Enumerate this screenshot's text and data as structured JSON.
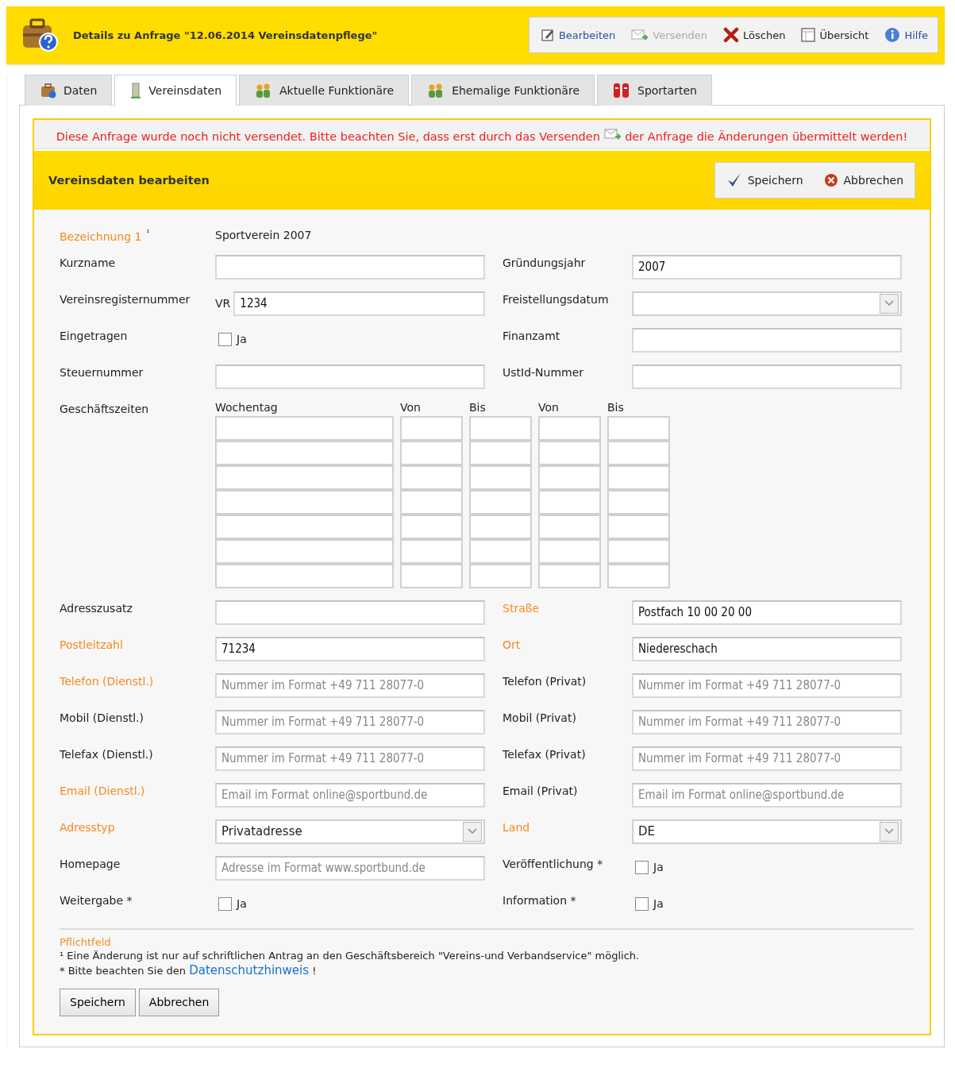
{
  "header": {
    "title": "Details zu  Anfrage \"12.06.2014 Vereinsdatenpflege\"",
    "actions": [
      {
        "kind": "edit",
        "label": "Bearbeiten",
        "disabled": false
      },
      {
        "kind": "send",
        "label": "Versenden",
        "disabled": true
      },
      {
        "kind": "delete",
        "label": "Löschen",
        "disabled": false
      },
      {
        "kind": "overview",
        "label": "Übersicht",
        "disabled": false
      },
      {
        "kind": "help",
        "label": "Hilfe",
        "disabled": false
      }
    ]
  },
  "tabs": [
    {
      "kind": "data",
      "label": "Daten",
      "selected": false
    },
    {
      "kind": "club",
      "label": "Vereinsdaten",
      "selected": true
    },
    {
      "kind": "people",
      "label": "Aktuelle Funktionäre",
      "selected": false
    },
    {
      "kind": "people",
      "label": "Ehemalige Funktionäre",
      "selected": false
    },
    {
      "kind": "sport",
      "label": "Sportarten",
      "selected": false
    }
  ],
  "notice": {
    "before": "Diese Anfrage wurde noch nicht versendet. Bitte beachten Sie, dass erst durch das Versenden",
    "after": "der Anfrage die Änderungen übermittelt werden!"
  },
  "section": {
    "title": "Vereinsdaten bearbeiten",
    "buttons": [
      {
        "kind": "save",
        "label": "Speichern"
      },
      {
        "kind": "cancel",
        "label": "Abbrechen"
      }
    ]
  },
  "rows": [
    [
      {
        "label": "Bezeichnung 1",
        "required": true,
        "marker": "¹",
        "kind": "static",
        "value": "Sportverein 2007"
      },
      null
    ],
    [
      {
        "label": "Kurzname",
        "required": false,
        "kind": "text"
      },
      {
        "label": "Gründungsjahr",
        "required": false,
        "kind": "text",
        "value": "2007"
      }
    ],
    [
      {
        "label": "Vereinsregisternummer",
        "required": false,
        "kind": "text",
        "prefix": "VR",
        "value": "1234"
      },
      {
        "label": "Freistellungsdatum",
        "required": false,
        "kind": "select"
      }
    ],
    [
      {
        "label": "Eingetragen",
        "required": false,
        "kind": "checkbox",
        "option": "Ja",
        "checked": false
      },
      {
        "label": "Finanzamt",
        "required": false,
        "kind": "text"
      }
    ],
    [
      {
        "label": "Steuernummer",
        "required": false,
        "kind": "text"
      },
      {
        "label": "UstId-Nummer",
        "required": false,
        "kind": "text"
      }
    ]
  ],
  "business_hours": {
    "label": "Geschäftszeiten",
    "columns": [
      "Wochentag",
      "Von",
      "Bis",
      "Von",
      "Bis"
    ],
    "rows": [
      {
        "kind": "blank"
      },
      {
        "kind": "blank"
      },
      {
        "kind": "blank"
      },
      {
        "kind": "blank"
      },
      {
        "kind": "blank"
      },
      {
        "kind": "blank"
      },
      {
        "kind": "blank"
      }
    ]
  },
  "rows2": [
    [
      {
        "label": "Adresszusatz",
        "required": false,
        "kind": "text"
      },
      {
        "label": "Straße",
        "required": true,
        "kind": "text",
        "value": "Postfach 10 00 20 00"
      }
    ],
    [
      {
        "label": "Postleitzahl",
        "required": true,
        "kind": "text",
        "value": "71234"
      },
      {
        "label": "Ort",
        "required": true,
        "kind": "text",
        "value": "Niedereschach"
      }
    ],
    [
      {
        "label": "Telefon (Dienstl.)",
        "required": true,
        "kind": "text",
        "placeholder": "Nummer im Format +49 711 28077-0"
      },
      {
        "label": "Telefon (Privat)",
        "required": false,
        "kind": "text",
        "placeholder": "Nummer im Format +49 711 28077-0"
      }
    ],
    [
      {
        "label": "Mobil (Dienstl.)",
        "required": false,
        "kind": "text",
        "placeholder": "Nummer im Format +49 711 28077-0"
      },
      {
        "label": "Mobil (Privat)",
        "required": false,
        "kind": "text",
        "placeholder": "Nummer im Format +49 711 28077-0"
      }
    ],
    [
      {
        "label": "Telefax (Dienstl.)",
        "required": false,
        "kind": "text",
        "placeholder": "Nummer im Format +49 711 28077-0"
      },
      {
        "label": "Telefax (Privat)",
        "required": false,
        "kind": "text",
        "placeholder": "Nummer im Format +49 711 28077-0"
      }
    ],
    [
      {
        "label": "Email (Dienstl.)",
        "required": true,
        "kind": "text",
        "placeholder": "Email im Format online@sportbund.de"
      },
      {
        "label": "Email (Privat)",
        "required": false,
        "kind": "text",
        "placeholder": "Email im Format online@sportbund.de"
      }
    ],
    [
      {
        "label": "Adresstyp",
        "required": true,
        "kind": "select",
        "value": "Privatadresse"
      },
      {
        "label": "Land",
        "required": true,
        "kind": "select",
        "value": "DE"
      }
    ],
    [
      {
        "label": "Homepage",
        "required": false,
        "kind": "text",
        "placeholder": "Adresse im Format www.sportbund.de"
      },
      {
        "label": "Veröffentlichung *",
        "required": false,
        "kind": "checkbox",
        "option": "Ja",
        "checked": false
      }
    ],
    [
      {
        "label": "Weitergabe *",
        "required": false,
        "kind": "checkbox",
        "option": "Ja",
        "checked": false
      },
      {
        "label": "Information *",
        "required": false,
        "kind": "checkbox",
        "option": "Ja",
        "checked": false
      }
    ]
  ],
  "footer": {
    "legend": "Pflichtfeld",
    "note1": "¹ Eine Änderung ist nur auf schriftlichen Antrag an den Geschäftsbereich \"Vereins-und Verbandservice\" möglich.",
    "note2_before": "* Bitte beachten Sie den",
    "note2_link": "Datenschutzhinweis",
    "note2_after": "!",
    "buttons": [
      {
        "label": "Speichern"
      },
      {
        "label": "Abbrechen"
      }
    ]
  }
}
